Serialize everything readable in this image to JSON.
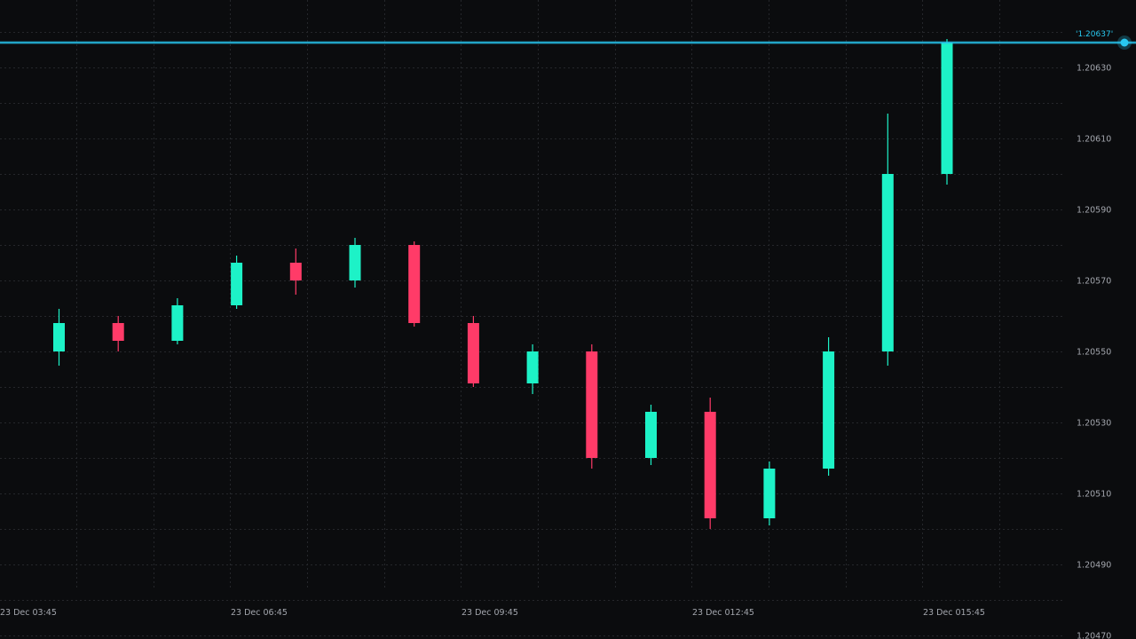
{
  "chart_data": {
    "type": "candlestick",
    "title": "",
    "xlabel": "",
    "ylabel": "",
    "ylim": [
      1.2047,
      1.2064
    ],
    "grid": true,
    "colors": {
      "up": "#1df2c7",
      "down": "#ff3b68",
      "price_line": "#28c8f0",
      "background": "#0b0c0e",
      "grid": "#25272b",
      "text": "#a3a6ad"
    },
    "y_ticks": [
      "1.20470",
      "1.20490",
      "1.20510",
      "1.20530",
      "1.20550",
      "1.20570",
      "1.20590",
      "1.20610",
      "1.20630"
    ],
    "x_ticks": [
      "23 Dec 03:45",
      "23 Dec 06:45",
      "23 Dec 09:45",
      "23 Dec 012:45",
      "23 Dec 015:45"
    ],
    "current_price": "'1.20637'",
    "current_price_value": 1.20637,
    "candles": [
      {
        "open": 1.2055,
        "high": 1.20562,
        "low": 1.20546,
        "close": 1.20558
      },
      {
        "open": 1.20558,
        "high": 1.2056,
        "low": 1.2055,
        "close": 1.20553
      },
      {
        "open": 1.20553,
        "high": 1.20565,
        "low": 1.20552,
        "close": 1.20563
      },
      {
        "open": 1.20563,
        "high": 1.20577,
        "low": 1.20562,
        "close": 1.20575
      },
      {
        "open": 1.20575,
        "high": 1.20579,
        "low": 1.20566,
        "close": 1.2057
      },
      {
        "open": 1.2057,
        "high": 1.20582,
        "low": 1.20568,
        "close": 1.2058
      },
      {
        "open": 1.2058,
        "high": 1.20581,
        "low": 1.20557,
        "close": 1.20558
      },
      {
        "open": 1.20558,
        "high": 1.2056,
        "low": 1.2054,
        "close": 1.20541
      },
      {
        "open": 1.20541,
        "high": 1.20552,
        "low": 1.20538,
        "close": 1.2055
      },
      {
        "open": 1.2055,
        "high": 1.20552,
        "low": 1.20517,
        "close": 1.2052
      },
      {
        "open": 1.2052,
        "high": 1.20535,
        "low": 1.20518,
        "close": 1.20533
      },
      {
        "open": 1.20533,
        "high": 1.20537,
        "low": 1.205,
        "close": 1.20503
      },
      {
        "open": 1.20503,
        "high": 1.20519,
        "low": 1.20501,
        "close": 1.20517
      },
      {
        "open": 1.20517,
        "high": 1.20554,
        "low": 1.20515,
        "close": 1.2055
      },
      {
        "open": 1.2055,
        "high": 1.20617,
        "low": 1.20546,
        "close": 1.206
      },
      {
        "open": 1.206,
        "high": 1.20638,
        "low": 1.20597,
        "close": 1.20637
      }
    ]
  }
}
